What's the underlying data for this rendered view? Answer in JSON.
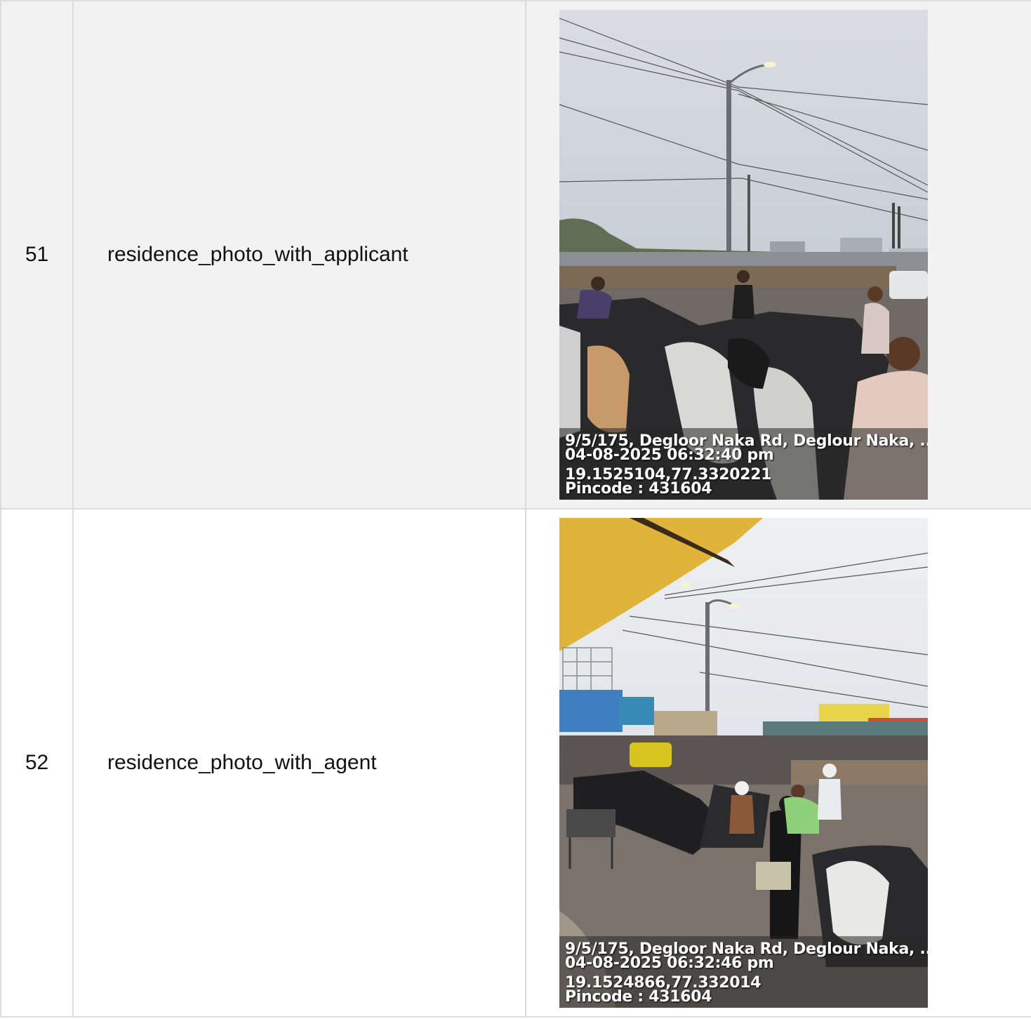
{
  "rows": [
    {
      "number": "51",
      "field": "residence_photo_with_applicant",
      "photo": {
        "address": "9/5/175, Degloor Naka Rd, Deglour Naka, ...",
        "datetime": "04-08-2025 06:32:40 pm",
        "coords": "19.1525104,77.3320221",
        "pincode": "Pincode : 431604"
      }
    },
    {
      "number": "52",
      "field": "residence_photo_with_agent",
      "photo": {
        "address": "9/5/175, Degloor Naka Rd, Deglour Naka, ...",
        "datetime": "04-08-2025 06:32:46 pm",
        "coords": "19.1524866,77.332014",
        "pincode": "Pincode : 431604"
      }
    }
  ]
}
